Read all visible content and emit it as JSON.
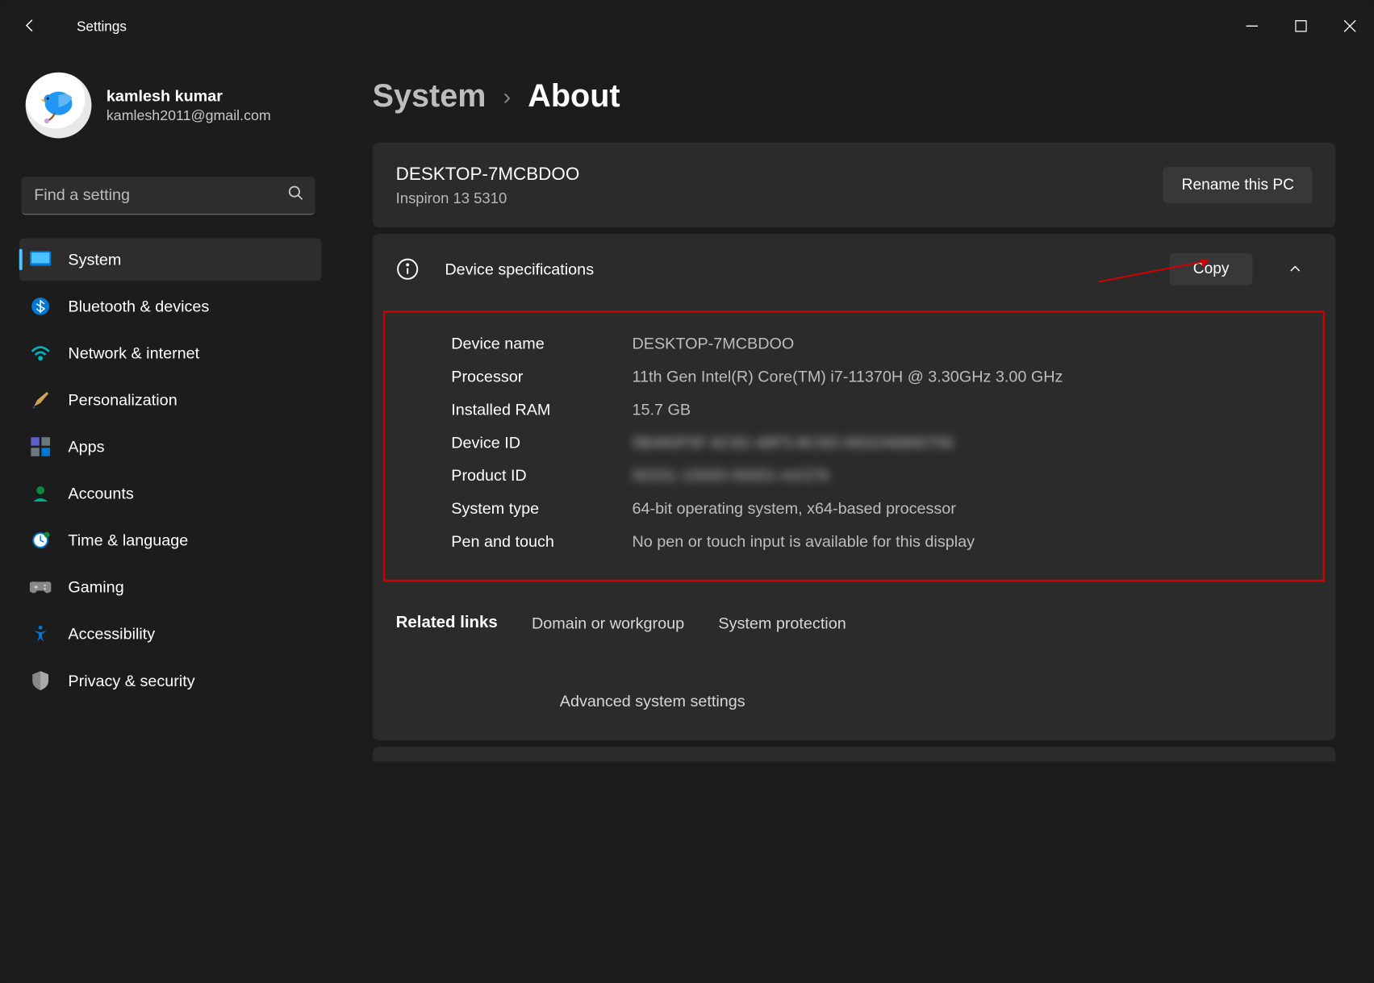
{
  "title": "Settings",
  "profile": {
    "name": "kamlesh kumar",
    "email": "kamlesh2011@gmail.com"
  },
  "search": {
    "placeholder": "Find a setting"
  },
  "nav": {
    "system": "System",
    "bluetooth": "Bluetooth & devices",
    "network": "Network & internet",
    "personalization": "Personalization",
    "apps": "Apps",
    "accounts": "Accounts",
    "time": "Time & language",
    "gaming": "Gaming",
    "accessibility": "Accessibility",
    "privacy": "Privacy & security"
  },
  "breadcrumb": {
    "parent": "System",
    "current": "About"
  },
  "pc": {
    "name": "DESKTOP-7MCBDOO",
    "model": "Inspiron 13 5310",
    "rename": "Rename this PC"
  },
  "deviceSpecs": {
    "heading": "Device specifications",
    "copy": "Copy",
    "rows": {
      "deviceName": {
        "label": "Device name",
        "value": "DESKTOP-7MCBDOO"
      },
      "processor": {
        "label": "Processor",
        "value": "11th Gen Intel(R) Core(TM) i7-11370H @ 3.30GHz   3.00 GHz"
      },
      "ram": {
        "label": "Installed RAM",
        "value": "15.7 GB"
      },
      "deviceId": {
        "label": "Device ID",
        "value": "5B460F5F-6C82-48F5-BC6D-8932A6800756"
      },
      "productId": {
        "label": "Product ID",
        "value": "00331-10000-00001-AA376"
      },
      "systemType": {
        "label": "System type",
        "value": "64-bit operating system, x64-based processor"
      },
      "penTouch": {
        "label": "Pen and touch",
        "value": "No pen or touch input is available for this display"
      }
    }
  },
  "related": {
    "label": "Related links",
    "domain": "Domain or workgroup",
    "protection": "System protection",
    "advanced": "Advanced system settings"
  }
}
